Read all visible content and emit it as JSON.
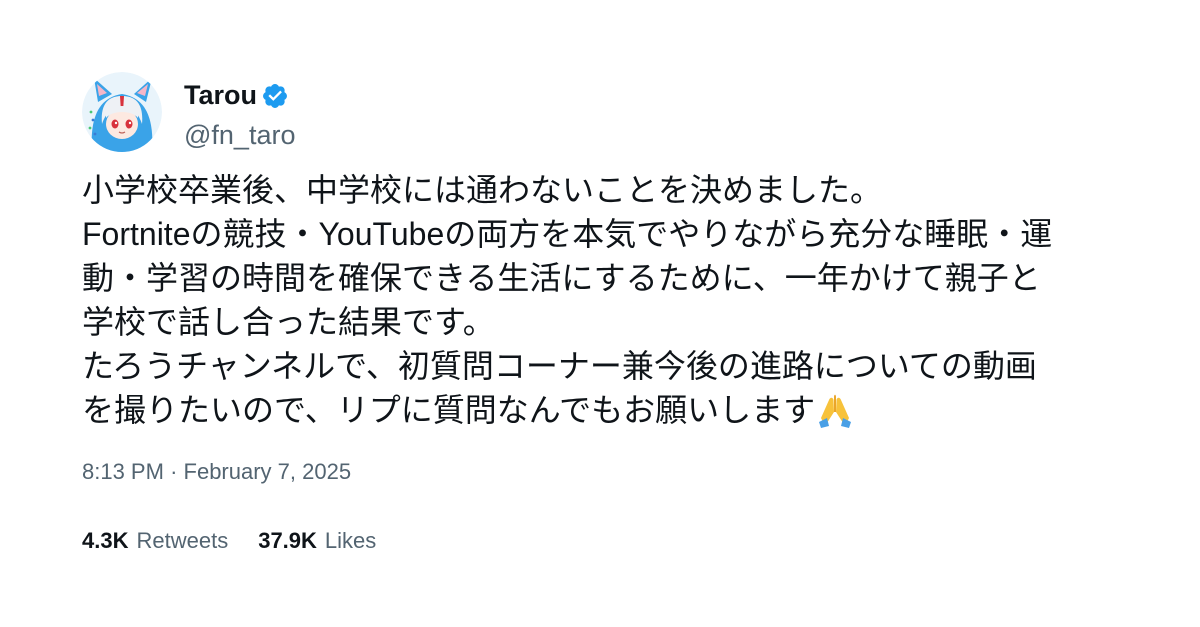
{
  "author": {
    "display_name": "Tarou",
    "handle": "@fn_taro",
    "avatar_icon": "avatar-icon",
    "verified_icon": "verified-badge-icon",
    "verified_color": "#1d9bf0"
  },
  "tweet": {
    "lines": [
      "小学校卒業後、中学校には通わないことを決めました。",
      "Fortniteの競技・YouTubeの両方を本気でやりながら充分な睡眠・運",
      "動・学習の時間を確保できる生活にするために、一年かけて親子と",
      "学校で話し合った結果です。",
      "たろうチャンネルで、初質問コーナー兼今後の進路についての動画",
      "を撮りたいので、リプに質問なんでもお願いします"
    ],
    "trailing_emoji": "folded-hands-emoji"
  },
  "meta": {
    "time": "8:13 PM",
    "separator": "·",
    "date": "February 7, 2025"
  },
  "stats": {
    "retweets_count": "4.3K",
    "retweets_label": "Retweets",
    "likes_count": "37.9K",
    "likes_label": "Likes"
  },
  "colors": {
    "text_primary": "#0f1419",
    "text_secondary": "#536471",
    "accent": "#1d9bf0"
  }
}
